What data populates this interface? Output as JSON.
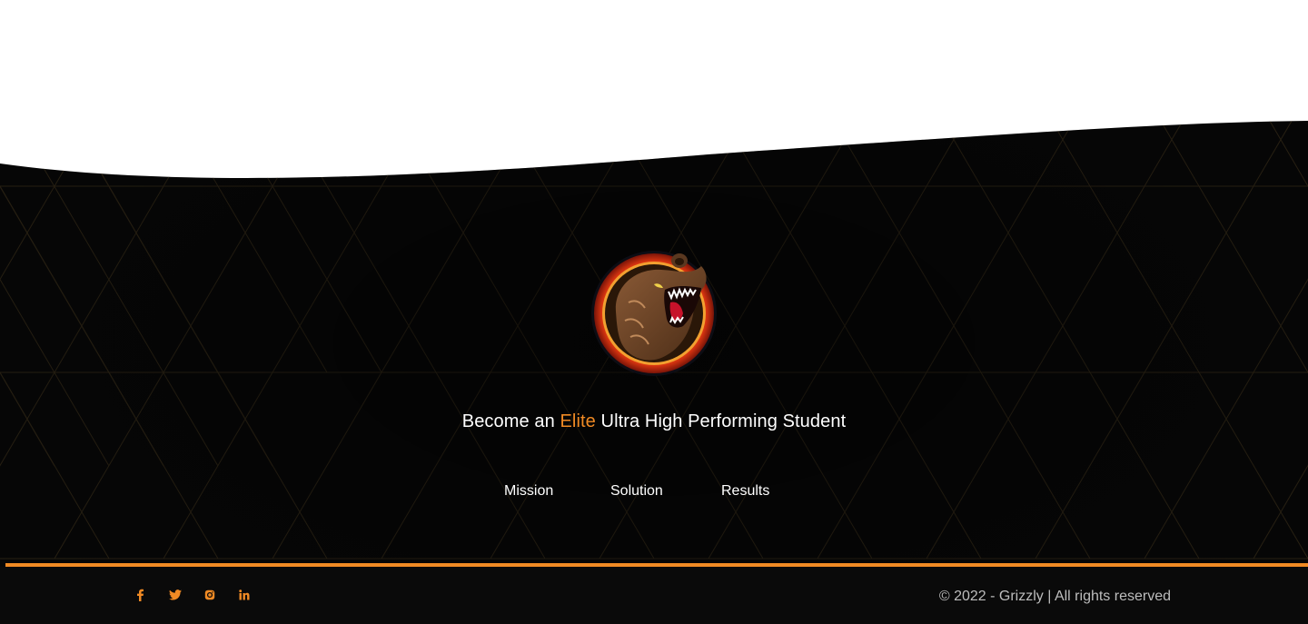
{
  "colors": {
    "accent": "#f08a24",
    "background_dark": "#070707",
    "pattern_line": "#3a3020",
    "text": "#ffffff",
    "muted_text": "#bdbdbd"
  },
  "brand": {
    "logo_icon": "grizzly-bear-logo",
    "tagline_before": "Become an ",
    "tagline_accent": "Elite",
    "tagline_after": " Ultra High Performing Student"
  },
  "nav": {
    "items": [
      {
        "label": "Mission"
      },
      {
        "label": "Solution"
      },
      {
        "label": "Results"
      }
    ]
  },
  "social": {
    "icons": [
      "facebook-icon",
      "twitter-icon",
      "instagram-icon",
      "linkedin-icon"
    ]
  },
  "footer": {
    "copyright": "© 2022 - Grizzly | All rights reserved"
  }
}
